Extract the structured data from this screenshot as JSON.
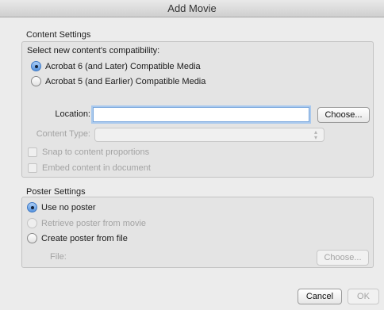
{
  "window": {
    "title": "Add Movie"
  },
  "content_settings": {
    "heading": "Content Settings",
    "compat_prompt": "Select new content's compatibility:",
    "compat_options": [
      {
        "label": "Acrobat 6 (and Later) Compatible Media",
        "selected": true
      },
      {
        "label": "Acrobat 5 (and Earlier) Compatible Media",
        "selected": false
      }
    ],
    "location_label": "Location:",
    "location_value": "",
    "choose_label": "Choose...",
    "content_type_label": "Content Type:",
    "content_type_value": "",
    "snap_label": "Snap to content proportions",
    "embed_label": "Embed content in document"
  },
  "poster_settings": {
    "heading": "Poster Settings",
    "options": [
      {
        "label": "Use no poster",
        "selected": true,
        "enabled": true
      },
      {
        "label": "Retrieve poster from movie",
        "selected": false,
        "enabled": false
      },
      {
        "label": "Create poster from file",
        "selected": false,
        "enabled": true
      }
    ],
    "file_label": "File:",
    "choose_label": "Choose..."
  },
  "footer": {
    "cancel_label": "Cancel",
    "ok_label": "OK"
  },
  "colors": {
    "focus_ring": "#7aa7dc",
    "radio_selected": "#5996e0",
    "disabled_text": "#a3a3a3"
  }
}
